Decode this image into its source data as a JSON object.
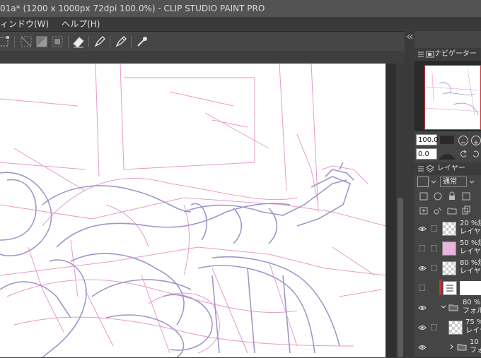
{
  "window": {
    "title": "01a* (1200 x 1000px 72dpi 100.0%)  - CLIP STUDIO PAINT PRO"
  },
  "menu": {
    "items": [
      "ィンドウ(W)",
      "ヘルプ(H)"
    ]
  },
  "toolbar": {
    "icons": [
      "transform-icon",
      "select-all-icon",
      "deselect-icon",
      "invert-selection-icon",
      "eraser-icon",
      "pen-icon",
      "pen-pressure-icon",
      "eyedropper-icon"
    ]
  },
  "navigator": {
    "tab_label": "ナビゲーター",
    "zoom_value": "100.0",
    "rotate_value": "0.0"
  },
  "layer_panel": {
    "tab_label": "レイヤー",
    "blend_mode": "通常",
    "layers": [
      {
        "line1": "20 %焼",
        "line2": "レイヤ",
        "visible": true
      },
      {
        "line1": "50 %焼",
        "line2": "レイヤ",
        "visible": false
      },
      {
        "line1": "80 %焼",
        "line2": "レイヤ",
        "visible": true
      },
      {
        "line1": "",
        "line2": "",
        "visible": false
      },
      {
        "line1": "80 %",
        "line2": "フォル",
        "visible": true
      },
      {
        "line1": "75 %",
        "line2": "レイヤ",
        "visible": true
      },
      {
        "line1": "10",
        "line2": "フォ",
        "visible": true
      }
    ]
  },
  "colors": {
    "sketch_pink": "#e79acb",
    "sketch_purple": "#9f97c9",
    "accent_red": "#d03030"
  }
}
